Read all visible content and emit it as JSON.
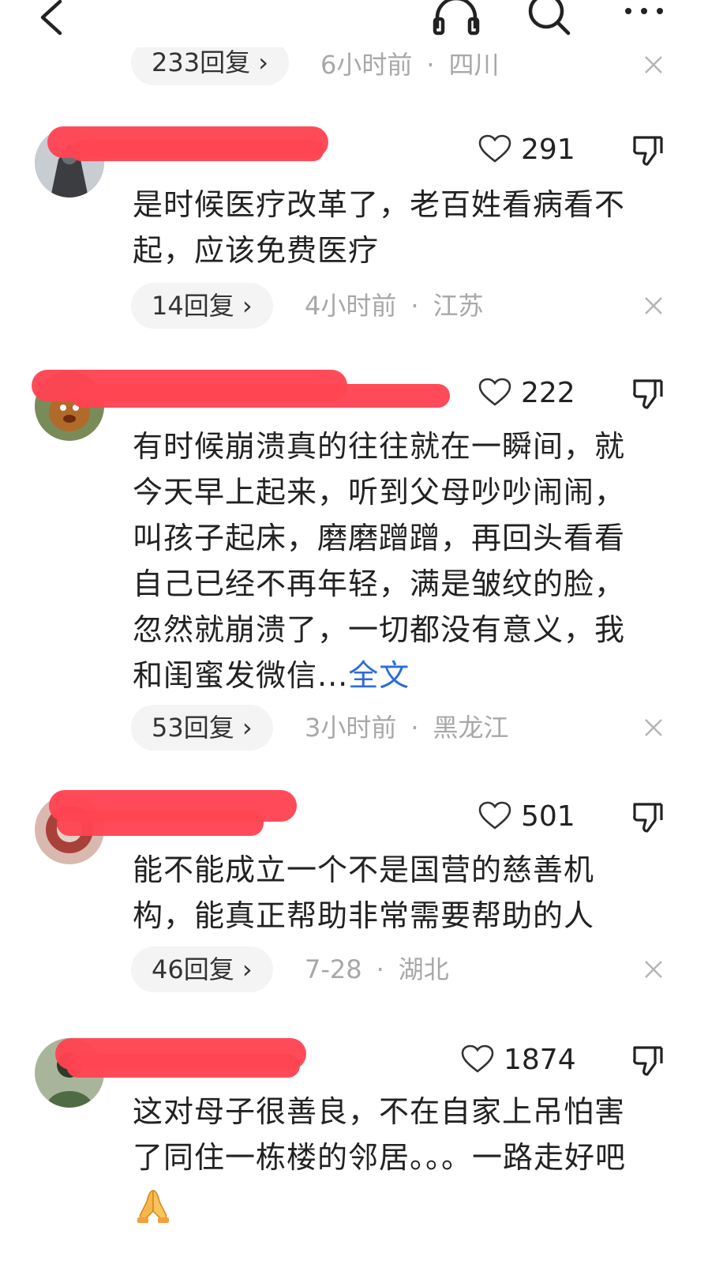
{
  "header": {
    "back_icon": "chevron-left-icon",
    "actions": [
      "headphones-icon",
      "search-icon",
      "more-icon"
    ]
  },
  "previous_comment": {
    "replies": "233回复 ›",
    "time": "6小时前",
    "location": "四川"
  },
  "comments": [
    {
      "likes": "291",
      "text": "是时候医疗改革了，老百姓看病看不起，应该免费医疗",
      "replies": "14回复 ›",
      "time": "4小时前",
      "location": "江苏"
    },
    {
      "likes": "222",
      "text": "有时候崩溃真的往往就在一瞬间，就今天早上起来，听到父母吵吵闹闹，叫孩子起床，磨磨蹭蹭，再回头看看自己已经不再年轻，满是皱纹的脸，忽然就崩溃了，一切都没有意义，我和闺蜜发微信...",
      "more": "全文",
      "replies": "53回复 ›",
      "time": "3小时前",
      "location": "黑龙江"
    },
    {
      "likes": "501",
      "text": "能不能成立一个不是国营的慈善机构，能真正帮助非常需要帮助的人",
      "replies": "46回复 ›",
      "time": "7-28",
      "location": "湖北"
    },
    {
      "likes": "1874",
      "text": "这对母子很善良，不在自家上吊怕害了同住一栋楼的邻居。。。一路走好吧"
    }
  ],
  "colors": {
    "redaction": "#ff4452",
    "link": "#2d6bdc",
    "meta": "#a8a8a8",
    "pill_bg": "#f4f4f4"
  }
}
